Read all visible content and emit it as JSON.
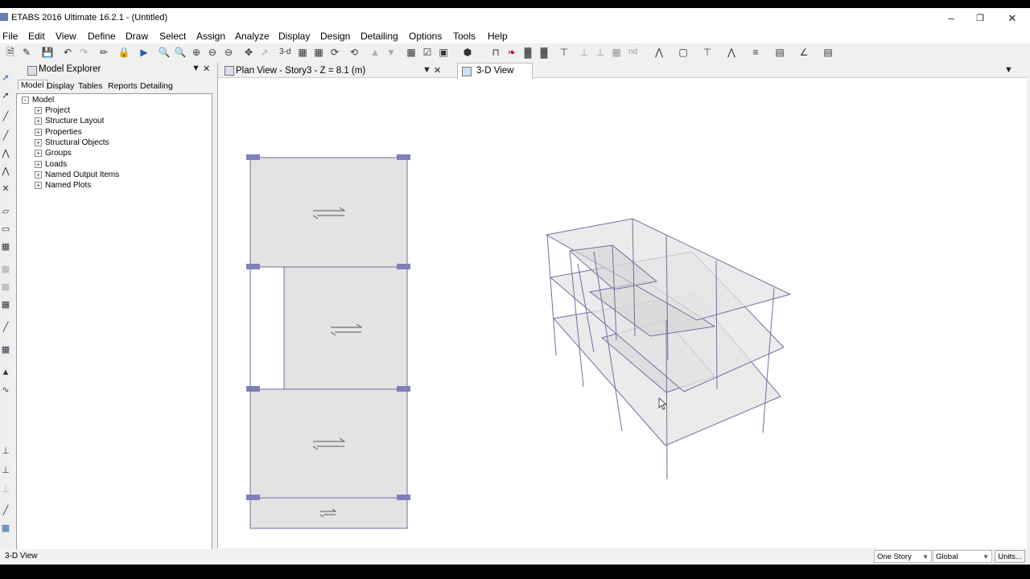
{
  "window": {
    "title": "ETABS 2016 Ultimate 16.2.1 - (Untitled)"
  },
  "menu": [
    "File",
    "Edit",
    "View",
    "Define",
    "Draw",
    "Select",
    "Assign",
    "Analyze",
    "Display",
    "Design",
    "Detailing",
    "Options",
    "Tools",
    "Help"
  ],
  "toolbar": {
    "view_3d_label": "3-d",
    "nd_label": "nd"
  },
  "explorer": {
    "title": "Model Explorer",
    "tabs": [
      "Model",
      "Display",
      "Tables",
      "Reports",
      "Detailing"
    ],
    "root": "Model",
    "items": [
      "Project",
      "Structure Layout",
      "Properties",
      "Structural Objects",
      "Groups",
      "Loads",
      "Named Output Items",
      "Named Plots"
    ]
  },
  "plan_view": {
    "title": "Plan View - Story3 - Z = 8.1 (m)"
  },
  "view3d": {
    "title": "3-D View"
  },
  "status": {
    "left": "3-D View",
    "story_select": "One Story",
    "coord_select": "Global",
    "units_button": "Units..."
  },
  "colors": {
    "slab_fill": "#e3e3e3",
    "frame_line": "#6f6fa4",
    "support": "#7f80b8"
  }
}
